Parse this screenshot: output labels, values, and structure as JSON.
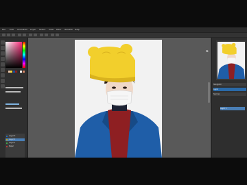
{
  "menubar": {
    "items": [
      "File",
      "Edit",
      "Animation",
      "Layer",
      "Select",
      "View",
      "Filter",
      "Window",
      "Help"
    ]
  },
  "layers_panel": {
    "rows": [
      {
        "label": "Layer 3",
        "color": "#1a6dbf",
        "selected": false
      },
      {
        "label": "Layer 2",
        "color": "#c8a80a",
        "selected": true
      },
      {
        "label": "Layer 1",
        "color": "#3aa84a",
        "selected": false
      },
      {
        "label": "Paper",
        "color": "#b83a3a",
        "selected": false
      }
    ]
  },
  "right_panel": {
    "tab1": "Navigator",
    "tab2": "Layer",
    "tab3": "Normal",
    "selected_layer": "Layer 2"
  },
  "canvas": {
    "background": "#595959",
    "paper": "#f2f2f2"
  },
  "palette": [
    "#3a2a20",
    "#e6c6a8",
    "#f2d23a",
    "#1a4f9c",
    "#8a1f1f",
    "#2a2a2a",
    "#ffffff",
    "#d98a6a"
  ]
}
